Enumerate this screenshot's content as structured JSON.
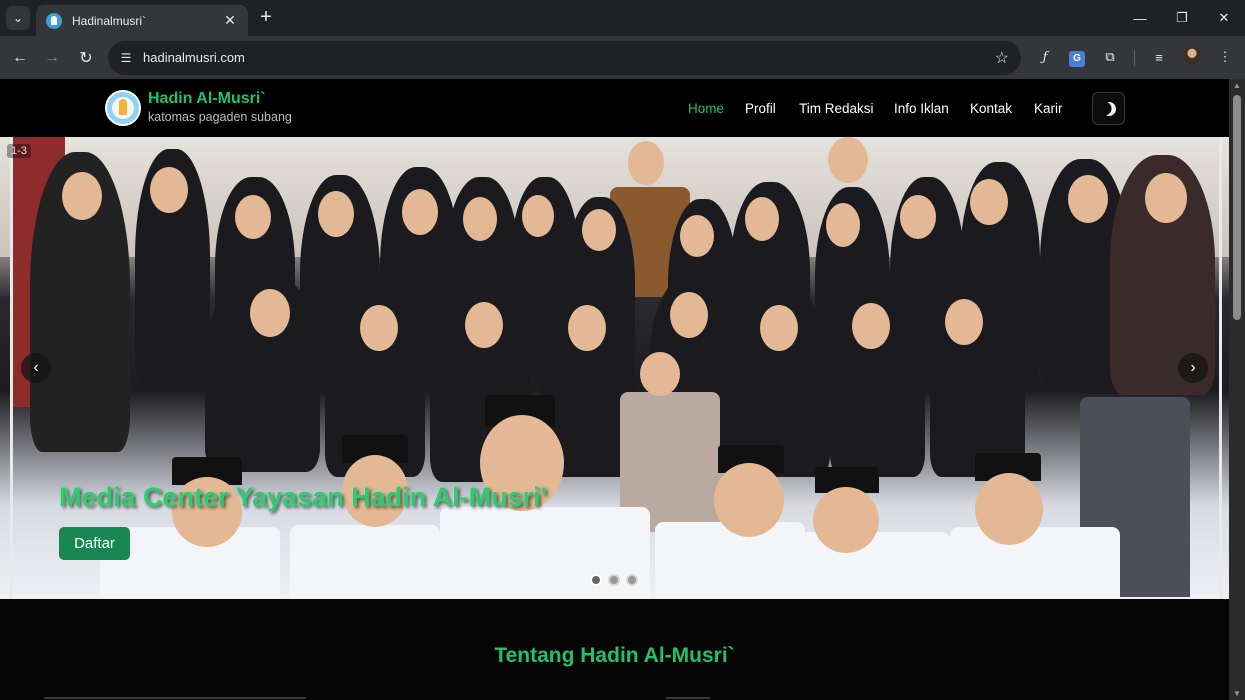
{
  "browser": {
    "tab_title": "Hadinalmusri`",
    "url": "hadinalmusri.com",
    "new_tab": "+",
    "tab_close": "✕",
    "minimize": "—",
    "restore": "❐",
    "close": "✕"
  },
  "site": {
    "brand_name": "Hadin Al-Musri`",
    "brand_tagline": "katomas pagaden subang",
    "nav": [
      "Home",
      "Profil",
      "Tim Redaksi",
      "Info Iklan",
      "Kontak",
      "Karir"
    ],
    "active_nav": "Home"
  },
  "hero": {
    "counter": "1-3",
    "title": "Media Center Yayasan Hadin Al-Musri'",
    "button_label": "Daftar",
    "slides": 3,
    "active_slide": 1
  },
  "about": {
    "title": "Tentang Hadin Al-Musri`"
  },
  "icons": {
    "back": "arrow-left-icon",
    "forward": "arrow-right-icon",
    "reload": "reload-icon",
    "star": "star-icon",
    "theme": "moon-icon"
  }
}
